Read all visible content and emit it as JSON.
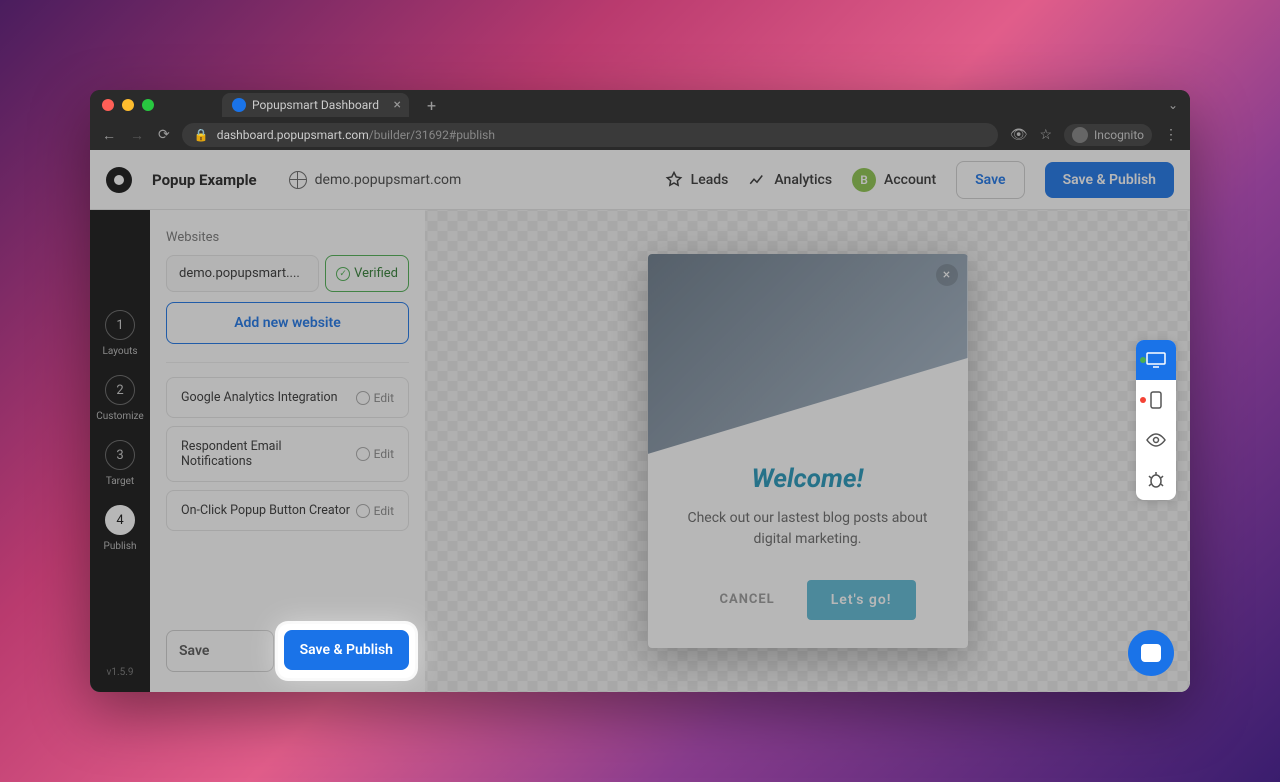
{
  "browser": {
    "tab_title": "Popupsmart Dashboard",
    "url_host": "dashboard.popupsmart.com",
    "url_path": "/builder/31692#publish",
    "incognito_label": "Incognito"
  },
  "header": {
    "popup_name": "Popup Example",
    "site": "demo.popupsmart.com",
    "leads_label": "Leads",
    "analytics_label": "Analytics",
    "account_initial": "B",
    "account_label": "Account",
    "save_label": "Save",
    "publish_label": "Save & Publish"
  },
  "sidenav": {
    "steps": [
      {
        "num": "1",
        "label": "Layouts"
      },
      {
        "num": "2",
        "label": "Customize"
      },
      {
        "num": "3",
        "label": "Target"
      },
      {
        "num": "4",
        "label": "Publish"
      }
    ],
    "version": "v1.5.9"
  },
  "panel": {
    "section_label": "Websites",
    "website_value": "demo.popupsmart....",
    "verified_label": "Verified",
    "add_website_label": "Add new website",
    "integrations": [
      {
        "label": "Google Analytics Integration",
        "edit": "Edit"
      },
      {
        "label": "Respondent Email Notifications",
        "edit": "Edit"
      },
      {
        "label": "On-Click Popup Button Creator",
        "edit": "Edit"
      }
    ],
    "footer_save": "Save",
    "footer_publish": "Save & Publish"
  },
  "popup": {
    "title": "Welcome!",
    "text": "Check out our lastest blog posts about digital marketing.",
    "cancel": "CANCEL",
    "go": "Let's go!"
  }
}
